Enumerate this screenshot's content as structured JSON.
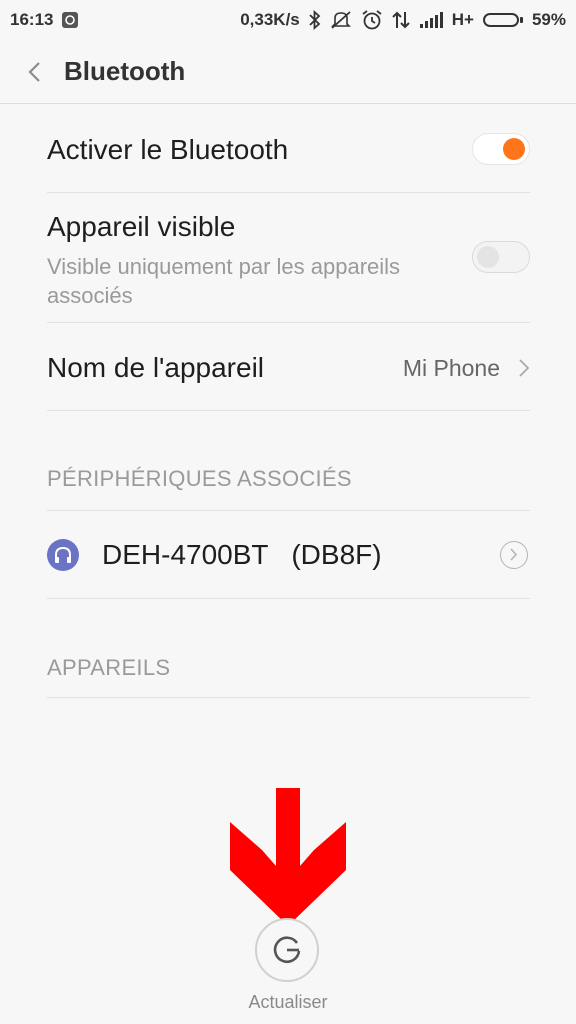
{
  "status_bar": {
    "time": "16:13",
    "speed": "0,33K/s",
    "network": "H+",
    "battery_percent": "59%",
    "battery_level": 0.59,
    "icons": [
      "gallery-notification-icon",
      "bluetooth-icon",
      "mute-icon",
      "alarm-icon",
      "data-transfer-icon",
      "signal-icon",
      "battery-icon"
    ]
  },
  "header": {
    "title": "Bluetooth"
  },
  "settings": {
    "enable_bluetooth": {
      "label": "Activer le Bluetooth",
      "on": true
    },
    "visible_device": {
      "label": "Appareil visible",
      "sublabel": "Visible uniquement par les appareils associés",
      "on": false
    },
    "device_name": {
      "label": "Nom de l'appareil",
      "value": "Mi Phone"
    }
  },
  "paired": {
    "header": "PÉRIPHÉRIQUES ASSOCIÉS",
    "devices": [
      {
        "name": "DEH-4700BT   (DB8F)",
        "icon": "headphones-icon"
      }
    ]
  },
  "available": {
    "header": "APPAREILS"
  },
  "refresh": {
    "label": "Actualiser"
  },
  "colors": {
    "accent": "#ff7519",
    "device_icon_bg": "#6b73c4",
    "annotation_arrow": "#ff0000"
  }
}
